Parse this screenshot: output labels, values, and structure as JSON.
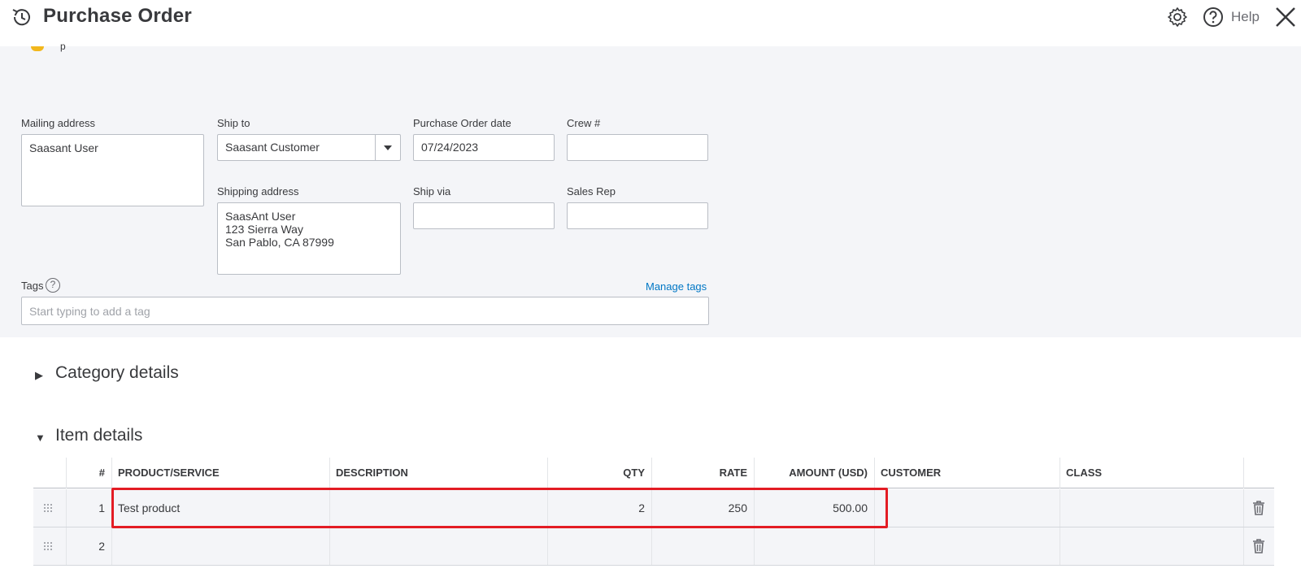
{
  "header": {
    "title": "Purchase Order",
    "help_label": "Help",
    "icons": [
      "history-icon",
      "gear-icon",
      "help-icon",
      "close-icon"
    ]
  },
  "form": {
    "peek_text": "p",
    "mailing_address": {
      "label": "Mailing address",
      "value": "Saasant User"
    },
    "ship_to": {
      "label": "Ship to",
      "value": "Saasant Customer"
    },
    "purchase_order_date": {
      "label": "Purchase Order date",
      "value": "07/24/2023"
    },
    "crew": {
      "label": "Crew #",
      "value": ""
    },
    "shipping_address": {
      "label": "Shipping address",
      "value": "SaasAnt User\n123 Sierra Way\nSan Pablo, CA  87999"
    },
    "ship_via": {
      "label": "Ship via",
      "value": ""
    },
    "sales_rep": {
      "label": "Sales Rep",
      "value": ""
    },
    "tags": {
      "label": "Tags",
      "help": "?",
      "manage_label": "Manage tags",
      "placeholder": "Start typing to add a tag"
    }
  },
  "sections": {
    "category": {
      "toggle": "▶",
      "title": "Category details"
    },
    "item": {
      "toggle": "▼",
      "title": "Item details"
    }
  },
  "table": {
    "columns": [
      "#",
      "PRODUCT/SERVICE",
      "DESCRIPTION",
      "QTY",
      "RATE",
      "AMOUNT (USD)",
      "CUSTOMER",
      "CLASS"
    ],
    "rows": [
      {
        "num": "1",
        "product": "Test product",
        "description": "",
        "qty": "2",
        "rate": "250",
        "amount": "500.00",
        "customer": "",
        "class": ""
      },
      {
        "num": "2",
        "product": "",
        "description": "",
        "qty": "",
        "rate": "",
        "amount": "",
        "customer": "",
        "class": ""
      }
    ]
  },
  "colors": {
    "accent_link": "#0077c5",
    "highlight": "#e31c24",
    "form_bg": "#f4f5f8"
  }
}
